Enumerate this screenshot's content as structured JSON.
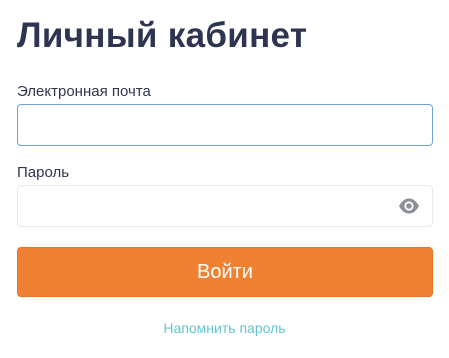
{
  "page": {
    "title": "Личный кабинет"
  },
  "form": {
    "email": {
      "label": "Электронная почта",
      "value": "",
      "placeholder": ""
    },
    "password": {
      "label": "Пароль",
      "value": "",
      "placeholder": "",
      "toggle_icon": "eye-icon"
    },
    "submit_label": "Войти",
    "remind_link": "Напомнить пароль"
  },
  "colors": {
    "title": "#2e3550",
    "accent_button": "#ef8132",
    "link": "#5fc7cf",
    "focused_border": "#6fa2d4",
    "input_border": "#e6e8eb",
    "icon": "#8a9099"
  }
}
